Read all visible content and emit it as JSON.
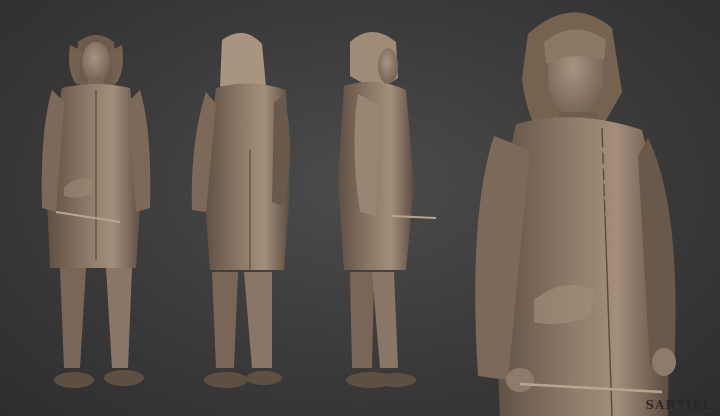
{
  "watermark": {
    "text": "SAR7IEL"
  },
  "colors": {
    "background": "#3a3a3a",
    "clay": "#8a7665",
    "clay_dark": "#5e4f43",
    "clay_light": "#a48e7b"
  }
}
